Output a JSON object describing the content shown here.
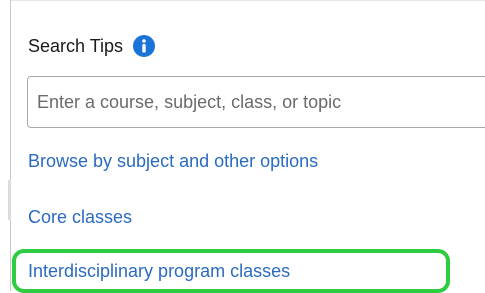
{
  "search_tips": {
    "label": "Search Tips",
    "icon": "info-icon",
    "icon_color": "#1a73d9"
  },
  "search": {
    "placeholder": "Enter a course, subject, class, or topic"
  },
  "links": {
    "browse": "Browse by subject and other options",
    "core": "Core classes",
    "interdisciplinary": "Interdisciplinary program classes"
  },
  "colors": {
    "link": "#2a6bbf",
    "highlight": "#2ecc40"
  }
}
